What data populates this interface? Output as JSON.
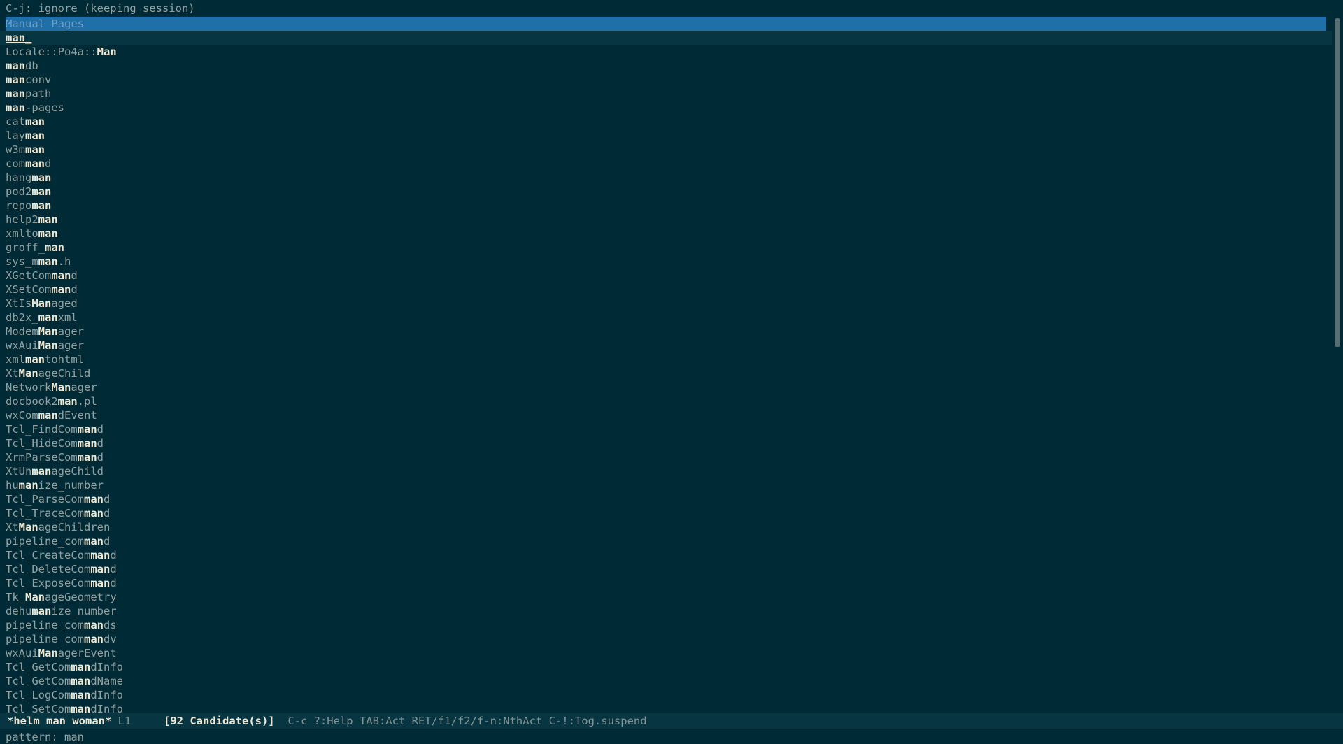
{
  "top_message": "C-j: ignore (keeping session)",
  "source_header": "Manual Pages",
  "selected_candidate": "man_",
  "candidates": [
    [
      "",
      "Locale::Po4a::",
      "Man",
      ""
    ],
    [
      "man",
      "db"
    ],
    [
      "man",
      "conv"
    ],
    [
      "man",
      "path"
    ],
    [
      "man",
      "-pages"
    ],
    [
      "cat",
      "man"
    ],
    [
      "lay",
      "man"
    ],
    [
      "w3m",
      "man"
    ],
    [
      "com",
      "man",
      "d"
    ],
    [
      "hang",
      "man"
    ],
    [
      "pod2",
      "man"
    ],
    [
      "repo",
      "man"
    ],
    [
      "help2",
      "man"
    ],
    [
      "xmlto",
      "man"
    ],
    [
      "groff_",
      "man"
    ],
    [
      "sys_m",
      "man",
      ".h"
    ],
    [
      "XGetCom",
      "man",
      "d"
    ],
    [
      "XSetCom",
      "man",
      "d"
    ],
    [
      "XtIs",
      "Man",
      "aged"
    ],
    [
      "db2x_",
      "man",
      "xml"
    ],
    [
      "Modem",
      "Man",
      "ager"
    ],
    [
      "wxAui",
      "Man",
      "ager"
    ],
    [
      "xml",
      "man",
      "tohtml"
    ],
    [
      "Xt",
      "Man",
      "ageChild"
    ],
    [
      "Network",
      "Man",
      "ager"
    ],
    [
      "docbook2",
      "man",
      ".pl"
    ],
    [
      "wxCom",
      "man",
      "dEvent"
    ],
    [
      "Tcl_FindCom",
      "man",
      "d"
    ],
    [
      "Tcl_HideCom",
      "man",
      "d"
    ],
    [
      "XrmParseCom",
      "man",
      "d"
    ],
    [
      "XtUn",
      "man",
      "ageChild"
    ],
    [
      "hu",
      "man",
      "ize_number"
    ],
    [
      "Tcl_ParseCom",
      "man",
      "d"
    ],
    [
      "Tcl_TraceCom",
      "man",
      "d"
    ],
    [
      "Xt",
      "Man",
      "ageChildren"
    ],
    [
      "pipeline_com",
      "man",
      "d"
    ],
    [
      "Tcl_CreateCom",
      "man",
      "d"
    ],
    [
      "Tcl_DeleteCom",
      "man",
      "d"
    ],
    [
      "Tcl_ExposeCom",
      "man",
      "d"
    ],
    [
      "Tk_",
      "Man",
      "ageGeometry"
    ],
    [
      "dehu",
      "man",
      "ize_number"
    ],
    [
      "pipeline_com",
      "man",
      "ds"
    ],
    [
      "pipeline_com",
      "man",
      "dv"
    ],
    [
      "wxAui",
      "Man",
      "agerEvent"
    ],
    [
      "Tcl_GetCom",
      "man",
      "dInfo"
    ],
    [
      "Tcl_GetCom",
      "man",
      "dName"
    ],
    [
      "Tcl_LogCom",
      "man",
      "dInfo"
    ],
    [
      "Tcl_SetCom",
      "man",
      "dInfo"
    ]
  ],
  "modeline": {
    "buffer_name": "*helm man woman*",
    "line": "L1",
    "candidate_count": "[92 Candidate(s)]",
    "keys_help": "C-c ?:Help TAB:Act RET/f1/f2/f-n:NthAct C-!:Tog.suspend"
  },
  "minibuffer": {
    "prompt": "pattern: ",
    "value": "man"
  },
  "colors": {
    "background": "#002b36",
    "header_bg": "#1f6fa8",
    "selection_bg": "#073642",
    "text": "#93a1a1",
    "match": "#eee8d5"
  }
}
